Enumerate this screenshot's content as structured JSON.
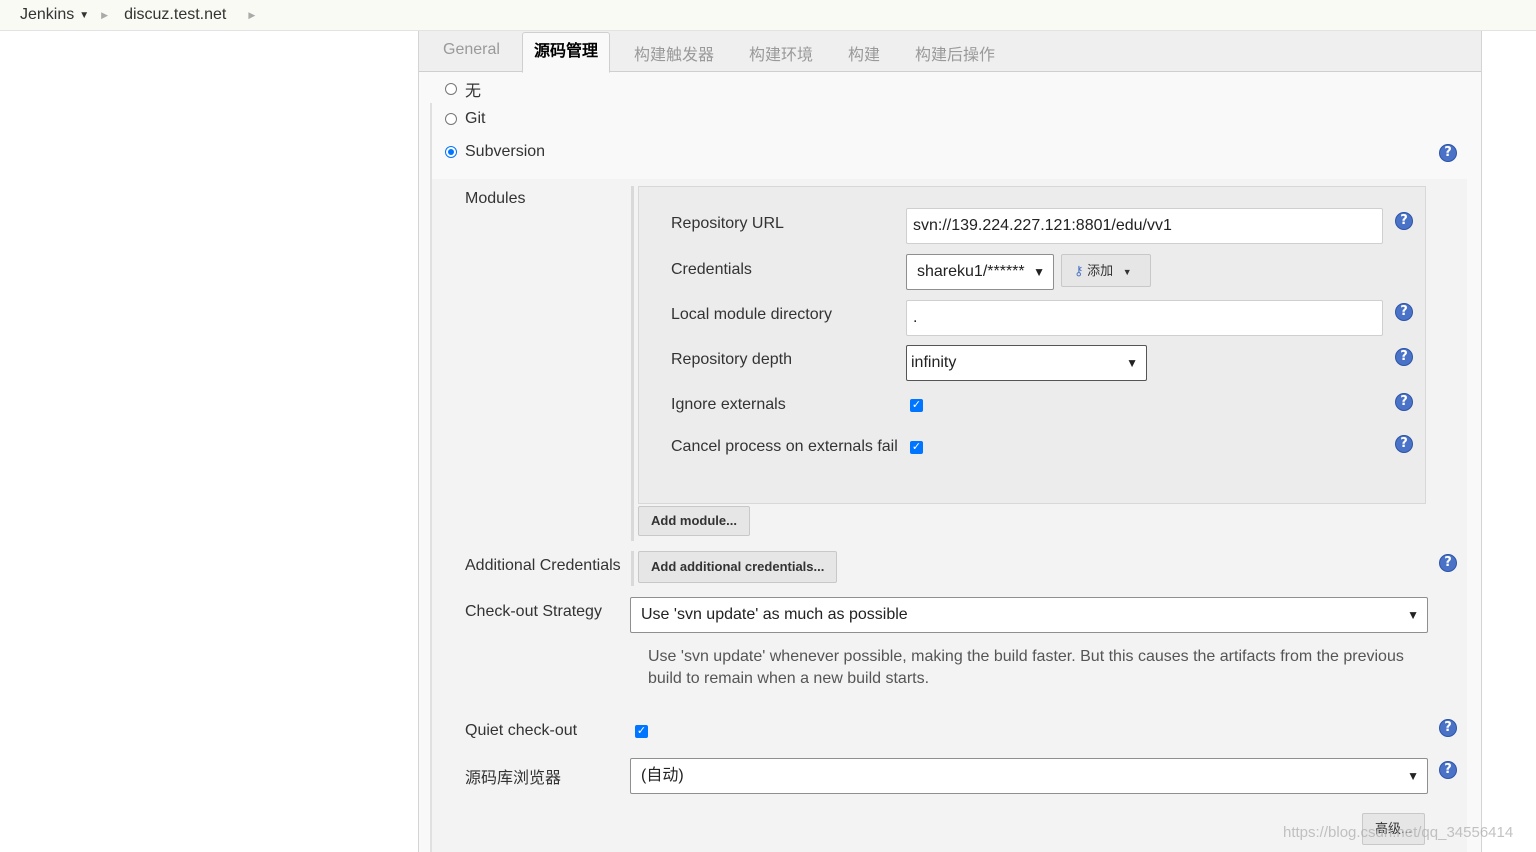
{
  "breadcrumb": {
    "root": "Jenkins",
    "project": "discuz.test.net"
  },
  "tabs": [
    "General",
    "源码管理",
    "构建触发器",
    "构建环境",
    "构建",
    "构建后操作"
  ],
  "scm": {
    "options": [
      "无",
      "Git",
      "Subversion"
    ],
    "selected": "Subversion"
  },
  "modules": {
    "section_label": "Modules",
    "repository_url_label": "Repository URL",
    "repository_url_value": "svn://139.224.227.121:8801/edu/vv1",
    "credentials_label": "Credentials",
    "credentials_value": "shareku1/******",
    "add_label": "添加",
    "local_dir_label": "Local module directory",
    "local_dir_value": ".",
    "depth_label": "Repository depth",
    "depth_value": "infinity",
    "ignore_externals_label": "Ignore externals",
    "cancel_externals_label": "Cancel process on externals fail",
    "add_module_label": "Add module..."
  },
  "additional_credentials": {
    "label": "Additional Credentials",
    "button": "Add additional credentials..."
  },
  "checkout_strategy": {
    "label": "Check-out Strategy",
    "value": "Use 'svn update' as much as possible",
    "description": "Use 'svn update' whenever possible, making the build faster. But this causes the artifacts from the previous build to remain when a new build starts."
  },
  "quiet_checkout": {
    "label": "Quiet check-out"
  },
  "repo_browser": {
    "label": "源码库浏览器",
    "value": "(自动)"
  },
  "advanced_button": "高级...",
  "watermark": "https://blog.csdn.net/qq_34556414"
}
